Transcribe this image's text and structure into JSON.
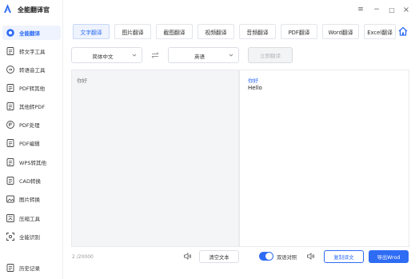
{
  "app": {
    "title": "全能翻译官"
  },
  "colors": {
    "accent": "#2f6cf4",
    "active_bg": "#eef3fd"
  },
  "sidebar": {
    "items": [
      {
        "label": "全能翻译",
        "icon": "target-icon",
        "active": true
      },
      {
        "label": "转文字工具",
        "icon": "text-convert-icon"
      },
      {
        "label": "转语音工具",
        "icon": "voice-icon"
      },
      {
        "label": "PDF转其他",
        "icon": "pdf-export-icon"
      },
      {
        "label": "其他转PDF",
        "icon": "pdf-import-icon"
      },
      {
        "label": "PDF处理",
        "icon": "pdf-process-icon"
      },
      {
        "label": "PDF编辑",
        "icon": "pdf-edit-icon"
      },
      {
        "label": "WPS转其他",
        "icon": "wps-icon"
      },
      {
        "label": "CAD转换",
        "icon": "cad-icon"
      },
      {
        "label": "图片转换",
        "icon": "image-icon"
      },
      {
        "label": "压缩工具",
        "icon": "compress-icon"
      },
      {
        "label": "全能识别",
        "icon": "scan-icon"
      },
      {
        "label": "历史记录",
        "icon": "history-icon"
      }
    ]
  },
  "window": {
    "menu": "≡",
    "minimize": "−",
    "maximize": "□",
    "close": "×"
  },
  "tabs": [
    "文字翻译",
    "图片翻译",
    "截图翻译",
    "视频翻译",
    "音频翻译",
    "PDF翻译",
    "Word翻译",
    "Excel翻译"
  ],
  "active_tab": 0,
  "lang": {
    "source": "简体中文",
    "target": "英语",
    "translate_btn": "立即翻译"
  },
  "source_panel": {
    "text": "你好"
  },
  "target_panel": {
    "title": "你好",
    "result": "Hello"
  },
  "footer": {
    "char_count": "2 /20000",
    "clear_btn": "清空文本",
    "toggle_label": "双语对照",
    "toggle_on": true,
    "copy_btn": "复制译文",
    "export_btn": "导出Wrod"
  }
}
